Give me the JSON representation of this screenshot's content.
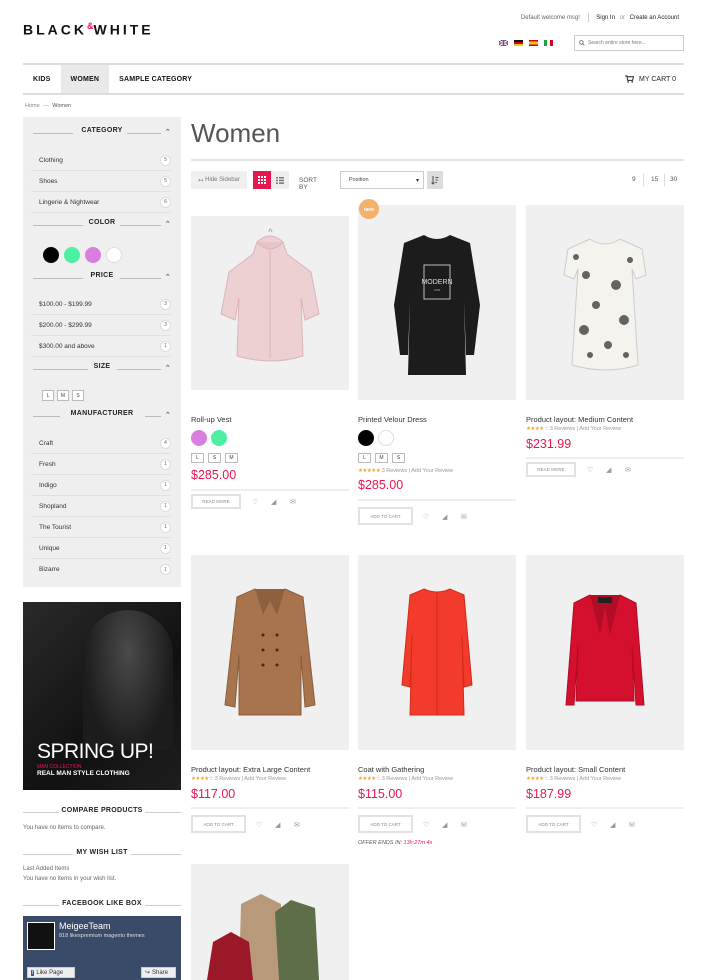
{
  "header": {
    "logo_a": "BLACK",
    "logo_amp": "&",
    "logo_b": "WHITE",
    "welcome": "Default welcome msg!",
    "sign_in": "Sign In",
    "or": "or",
    "create_account": "Create an Account",
    "search_placeholder": "Search entire store here...",
    "flag_colors": [
      "#1f3c88",
      "#d0021b",
      "#f5c518",
      "#2a9d3f"
    ]
  },
  "nav": {
    "items": [
      "KIDS",
      "WOMEN",
      "SAMPLE CATEGORY"
    ],
    "active": "WOMEN",
    "cart": "MY CART 0"
  },
  "breadcrumb": {
    "home": "Home",
    "current": "Women"
  },
  "sidebar": {
    "category": {
      "title": "CATEGORY",
      "items": [
        {
          "label": "Clothing",
          "count": "5"
        },
        {
          "label": "Shoes",
          "count": "5"
        },
        {
          "label": "Lingerie & Nightwear",
          "count": "6"
        }
      ]
    },
    "color": {
      "title": "COLOR",
      "swatches": [
        "#000000",
        "#4cf0a0",
        "#d97ee0",
        "#ffffff"
      ]
    },
    "price": {
      "title": "PRICE",
      "items": [
        {
          "label": "$100.00 - $199.99",
          "count": "3"
        },
        {
          "label": "$200.00 - $299.99",
          "count": "3"
        },
        {
          "label": "$300.00 and above",
          "count": "1"
        }
      ]
    },
    "size": {
      "title": "SIZE",
      "options": [
        "L",
        "M",
        "S"
      ]
    },
    "manufacturer": {
      "title": "MANUFACTURER",
      "items": [
        {
          "label": "Craft",
          "count": "4"
        },
        {
          "label": "Fresh",
          "count": "1"
        },
        {
          "label": "Indigo",
          "count": "1"
        },
        {
          "label": "Shopland",
          "count": "1"
        },
        {
          "label": "The Tourist",
          "count": "1"
        },
        {
          "label": "Unique",
          "count": "1"
        },
        {
          "label": "Bizarre",
          "count": "1"
        }
      ]
    },
    "banner": {
      "headline": "SPRING UP!",
      "sub": "MAN COLLECTION",
      "tagline": "REAL MAN STYLE CLOTHING"
    },
    "compare": {
      "title": "COMPARE PRODUCTS",
      "text": "You have no items to compare."
    },
    "wishlist": {
      "title": "MY WISH LIST",
      "line1": "Last Added Items",
      "line2": "You have no items in your wish list."
    },
    "facebook": {
      "title": "FACEBOOK LIKE BOX",
      "name": "MeigeeTeam",
      "likes": "818 likes",
      "likes_extra": "premium magento themes",
      "like_btn": "Like Page",
      "share_btn": "Share"
    }
  },
  "main": {
    "title": "Women",
    "hide_sidebar": "Hide Sidebar",
    "sort_by": "SORT BY",
    "sort_value": "Position",
    "per_page": [
      "9",
      "15",
      "30"
    ],
    "review_text": "Reviews",
    "add_review": "Add Your Review",
    "read_more": "READ MORE",
    "add_to_cart": "ADD TO CART",
    "new_badge": "NEW",
    "offer_label": "OFFER ENDS IN:",
    "offer_time": "13h:27m 4s",
    "products": [
      {
        "name": "Roll-up Vest",
        "price": "$285.00",
        "colors": [
          "#d97ee0",
          "#4cf0a0"
        ],
        "sizes": [
          "L",
          "S",
          "M"
        ],
        "button": "READ MORE"
      },
      {
        "name": "Printed Velour Dress",
        "price": "$285.00",
        "colors": [
          "#000000",
          "#ffffff"
        ],
        "sizes": [
          "L",
          "M",
          "S"
        ],
        "reviews": "3",
        "rating": 5,
        "button": "ADD TO CART"
      },
      {
        "name": "Product layout: Medium Content",
        "price": "$231.99",
        "reviews": "3",
        "rating": 4,
        "button": "READ MORE"
      },
      {
        "name": "Product layout: Extra Large Content",
        "price": "$117.00",
        "reviews": "3",
        "rating": 4,
        "button": "ADD TO CART"
      },
      {
        "name": "Coat with Gathering",
        "price": "$115.00",
        "reviews": "3",
        "rating": 4,
        "button": "ADD TO CART"
      },
      {
        "name": "Product layout: Small Content",
        "price": "$187.99",
        "reviews": "3",
        "rating": 4,
        "button": "ADD TO CART"
      }
    ],
    "print_label": "MODERN",
    "print_sub": "1999"
  }
}
